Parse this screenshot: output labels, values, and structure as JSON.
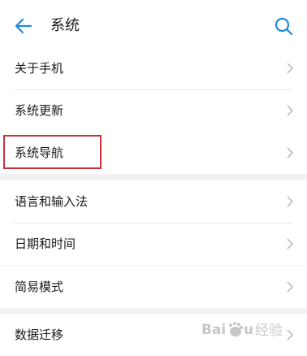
{
  "header": {
    "title": "系统",
    "back_icon": "arrow-left-icon",
    "search_icon": "search-icon",
    "accent_color": "#1f8ad6"
  },
  "groups": [
    {
      "items": [
        {
          "label": "关于手机"
        },
        {
          "label": "系统更新"
        }
      ]
    },
    {
      "items": [
        {
          "label": "系统导航"
        }
      ]
    },
    {
      "items": [
        {
          "label": "语言和输入法"
        },
        {
          "label": "日期和时间"
        }
      ]
    },
    {
      "items": [
        {
          "label": "简易模式"
        }
      ]
    },
    {
      "items": [
        {
          "label": "数据迁移"
        }
      ]
    }
  ],
  "highlight_color": "#c8323a",
  "watermark": {
    "text": "Baidu 经验"
  }
}
